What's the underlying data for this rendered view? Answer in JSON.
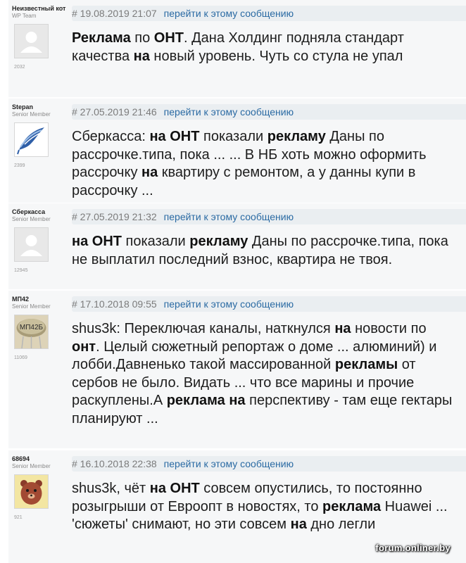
{
  "posts": [
    {
      "username": "Неизвестный кот",
      "rank": "WP Team",
      "count": "2032",
      "avatar": "default-avatar-icon",
      "date": "# 19.08.2019 21:07",
      "link": "перейти к этому сообщению",
      "body": [
        {
          "t": "Реклама",
          "b": true
        },
        {
          "t": " по ",
          "b": false
        },
        {
          "t": "ОНТ",
          "b": true
        },
        {
          "t": ". Дана Холдинг подняла стандарт качества ",
          "b": false
        },
        {
          "t": "на",
          "b": true
        },
        {
          "t": " новый уровень. Чуть со стула не упал",
          "b": false
        }
      ]
    },
    {
      "username": "Stepan",
      "rank": "Senior Member",
      "count": "2399",
      "avatar": "blue-feather-avatar-icon",
      "date": "# 27.05.2019 21:46",
      "link": "перейти к этому сообщению",
      "body": [
        {
          "t": "Сберкасса: ",
          "b": false
        },
        {
          "t": "на ОНТ",
          "b": true
        },
        {
          "t": " показали ",
          "b": false
        },
        {
          "t": "рекламу",
          "b": true
        },
        {
          "t": " Даны по рассрочке.типа, пока ... ... В НБ хоть можно оформить рассрочку ",
          "b": false
        },
        {
          "t": "на",
          "b": true
        },
        {
          "t": " квартиру с ремонтом, а у данны купи в рассрочку ...",
          "b": false
        }
      ]
    },
    {
      "username": "Сберкасса",
      "rank": "Senior Member",
      "count": "12945",
      "avatar": "default-avatar-icon",
      "date": "# 27.05.2019 21:32",
      "link": "перейти к этому сообщению",
      "body": [
        {
          "t": "на ОНТ",
          "b": true
        },
        {
          "t": " показали ",
          "b": false
        },
        {
          "t": "рекламу",
          "b": true
        },
        {
          "t": " Даны по рассрочке.типа, пока не выплатил последний взнос, квартира не твоя.",
          "b": false
        }
      ]
    },
    {
      "username": "МП42",
      "rank": "Senior Member",
      "count": "11069",
      "avatar": "transistor-avatar-icon",
      "avatar_text": "МП42Б",
      "date": "# 17.10.2018 09:55",
      "link": "перейти к этому сообщению",
      "body": [
        {
          "t": "shus3k: Переключая каналы, наткнулся ",
          "b": false
        },
        {
          "t": "на",
          "b": true
        },
        {
          "t": " новости по ",
          "b": false
        },
        {
          "t": "онт",
          "b": true
        },
        {
          "t": ". Целый сюжетный репортаж о доме ... алюминий) и лобби.Давненько такой массированной ",
          "b": false
        },
        {
          "t": "рекламы",
          "b": true
        },
        {
          "t": " от сербов не было. Видать ... что все марины и прочие раскуплены.А ",
          "b": false
        },
        {
          "t": "реклама на",
          "b": true
        },
        {
          "t": " перспективу - там еще гектары планируют ...",
          "b": false
        }
      ]
    },
    {
      "username": "68694",
      "rank": "Senior Member",
      "count": "921",
      "avatar": "bear-avatar-icon",
      "date": "# 16.10.2018 22:38",
      "link": "перейти к этому сообщению",
      "body": [
        {
          "t": "shus3k, чёт ",
          "b": false
        },
        {
          "t": "на ОНТ",
          "b": true
        },
        {
          "t": " совсем опустились, то постоянно розыгрыши от Евроопт в новостях, то ",
          "b": false
        },
        {
          "t": "реклама",
          "b": true
        },
        {
          "t": " Huawei ... 'сюжеты' снимают, но эти совсем ",
          "b": false
        },
        {
          "t": "на",
          "b": true
        },
        {
          "t": " дно легли",
          "b": false
        }
      ]
    }
  ],
  "watermark": "forum.onliner.by",
  "colors": {
    "link": "#2a6aa3",
    "header_bg": "#eaeef1",
    "post_bg": "#f6f7f8"
  }
}
